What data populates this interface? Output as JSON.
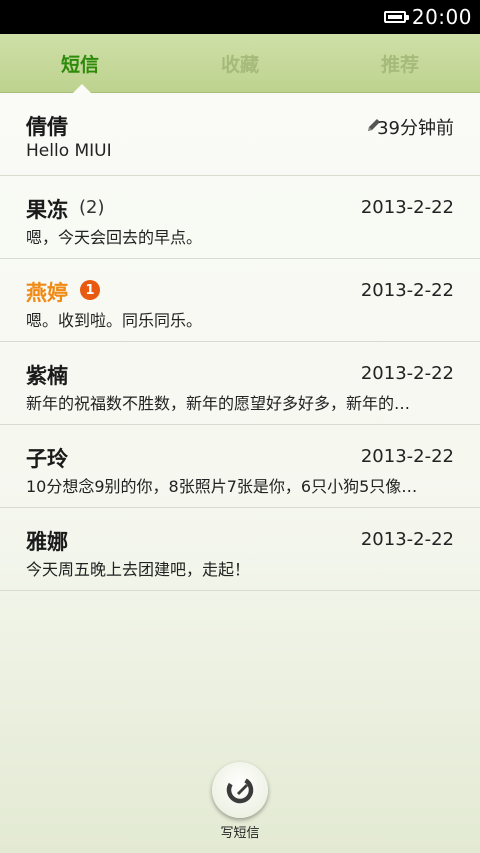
{
  "status": {
    "time": "20:00"
  },
  "tabs": [
    {
      "label": "短信",
      "active": true
    },
    {
      "label": "收藏",
      "active": false
    },
    {
      "label": "推荐",
      "active": false
    }
  ],
  "messages": [
    {
      "name": "倩倩",
      "count": "",
      "badge": "",
      "time": "39分钟前",
      "snippet": "Hello MIUI"
    },
    {
      "name": "果冻",
      "count": "(2)",
      "badge": "",
      "time": "2013-2-22",
      "snippet": "嗯，今天会回去的早点。"
    },
    {
      "name": "燕婷",
      "count": "",
      "badge": "1",
      "time": "2013-2-22",
      "snippet": "嗯。收到啦。同乐同乐。"
    },
    {
      "name": "紫楠",
      "count": "",
      "badge": "",
      "time": "2013-2-22",
      "snippet": "新年的祝福数不胜数，新年的愿望好多好多，新年的…"
    },
    {
      "name": "子玲",
      "count": "",
      "badge": "",
      "time": "2013-2-22",
      "snippet": "10分想念9别的你，8张照片7张是你，6只小狗5只像…"
    },
    {
      "name": "雅娜",
      "count": "",
      "badge": "",
      "time": "2013-2-22",
      "snippet": "今天周五晚上去团建吧，走起！"
    }
  ],
  "compose": {
    "label": "写短信"
  },
  "colors": {
    "accent": "#2d8a0a",
    "unread_name": "#f08a15",
    "badge": "#e85a10",
    "tabbar": "#c6d89b"
  }
}
